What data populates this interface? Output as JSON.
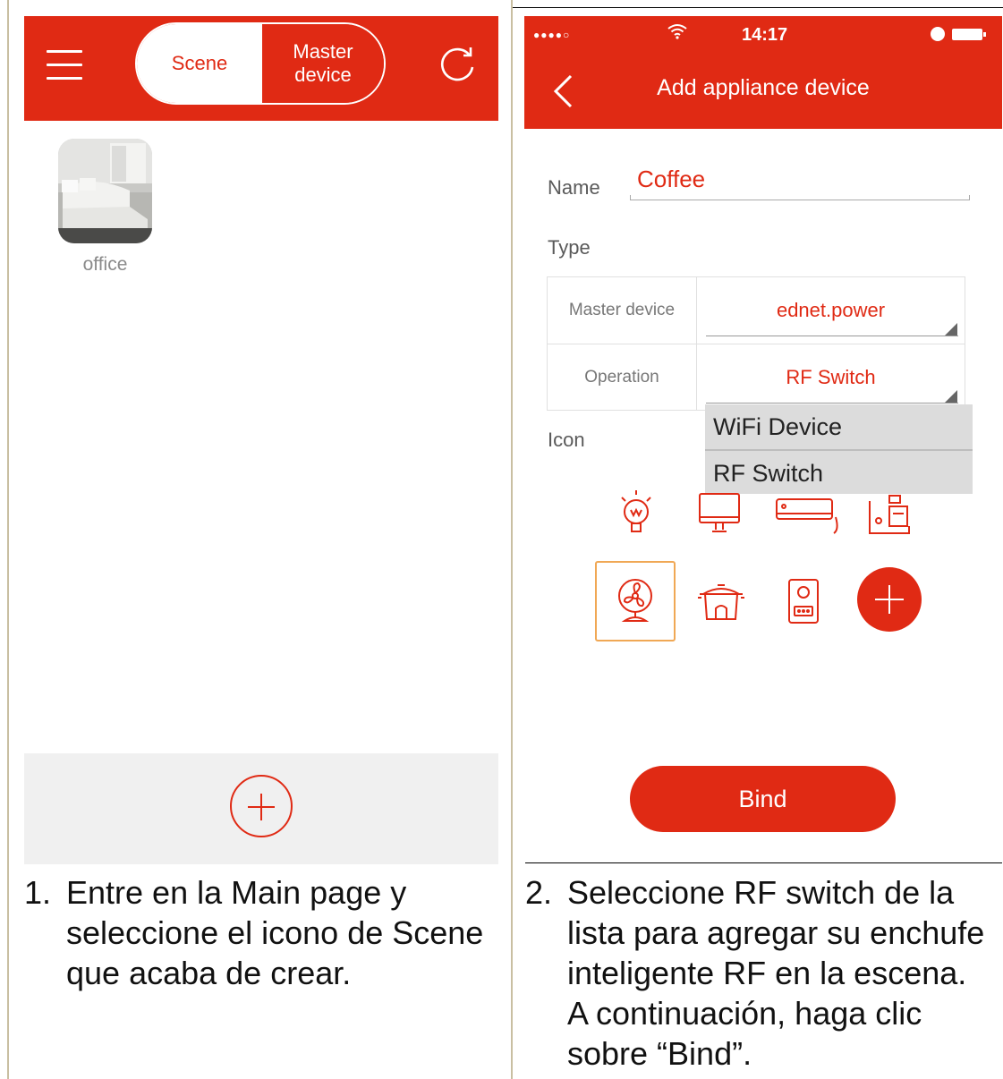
{
  "left": {
    "header": {
      "segment_scene": "Scene",
      "segment_master": "Master device"
    },
    "scene_label": "office",
    "caption_num": "1.",
    "caption_text": [
      "Entre en la Main page y",
      "seleccione el icono de Scene",
      "que acaba de crear."
    ]
  },
  "right": {
    "status": {
      "signal": "●●●●○",
      "time": "14:17"
    },
    "header": {
      "title": "Add appliance device"
    },
    "form": {
      "name_label": "Name",
      "name_value": "Coffee",
      "type_label": "Type",
      "master_device_label": "Master device",
      "master_device_value": "ednet.power",
      "operation_label": "Operation",
      "operation_value": "RF Switch",
      "icon_label": "Icon"
    },
    "dropdown": {
      "options": [
        "WiFi Device",
        "RF Switch"
      ]
    },
    "icons": [
      "light-bulb-icon",
      "monitor-icon",
      "air-conditioner-icon",
      "coffee-machine-icon",
      "fan-icon",
      "rice-cooker-icon",
      "water-heater-icon",
      "add-icon"
    ],
    "bind_label": "Bind",
    "caption_num": "2.",
    "caption_text": [
      "Seleccione RF switch de la",
      "lista para agregar su enchufe",
      "inteligente RF en la escena.",
      "A continuación, haga clic",
      "sobre “Bind”."
    ]
  },
  "colors": {
    "accent": "#e02a14",
    "highlight": "#f0a855",
    "dropdown_bg": "#dcdcdc"
  }
}
